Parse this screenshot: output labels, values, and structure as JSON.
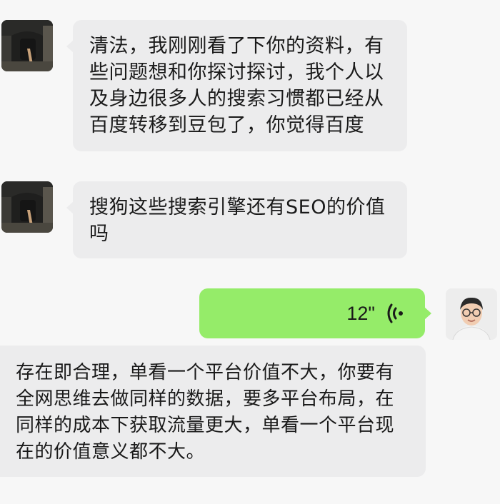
{
  "messages": [
    {
      "side": "left",
      "text": "清法，我刚刚看了下你的资料，有些问题想和你探讨探讨，我个人以及身边很多人的搜索习惯都已经从百度转移到豆包了，你觉得百度"
    },
    {
      "side": "left",
      "text": "搜狗这些搜索引擎还有SEO的价值吗"
    },
    {
      "side": "right",
      "type": "voice",
      "duration": "12\"",
      "icon": "voice-wave-icon"
    },
    {
      "side": "left",
      "text": "存在即合理，单看一个平台价值不大，你要有全网思维去做同样的数据，要多平台布局，在同样的成本下获取流量更大，单看一个平台现在的价值意义都不大。"
    }
  ],
  "colors": {
    "background": "#f7f7f7",
    "received_bubble": "#ececed",
    "sent_bubble": "#95ec69",
    "text": "#1a1a1a"
  }
}
